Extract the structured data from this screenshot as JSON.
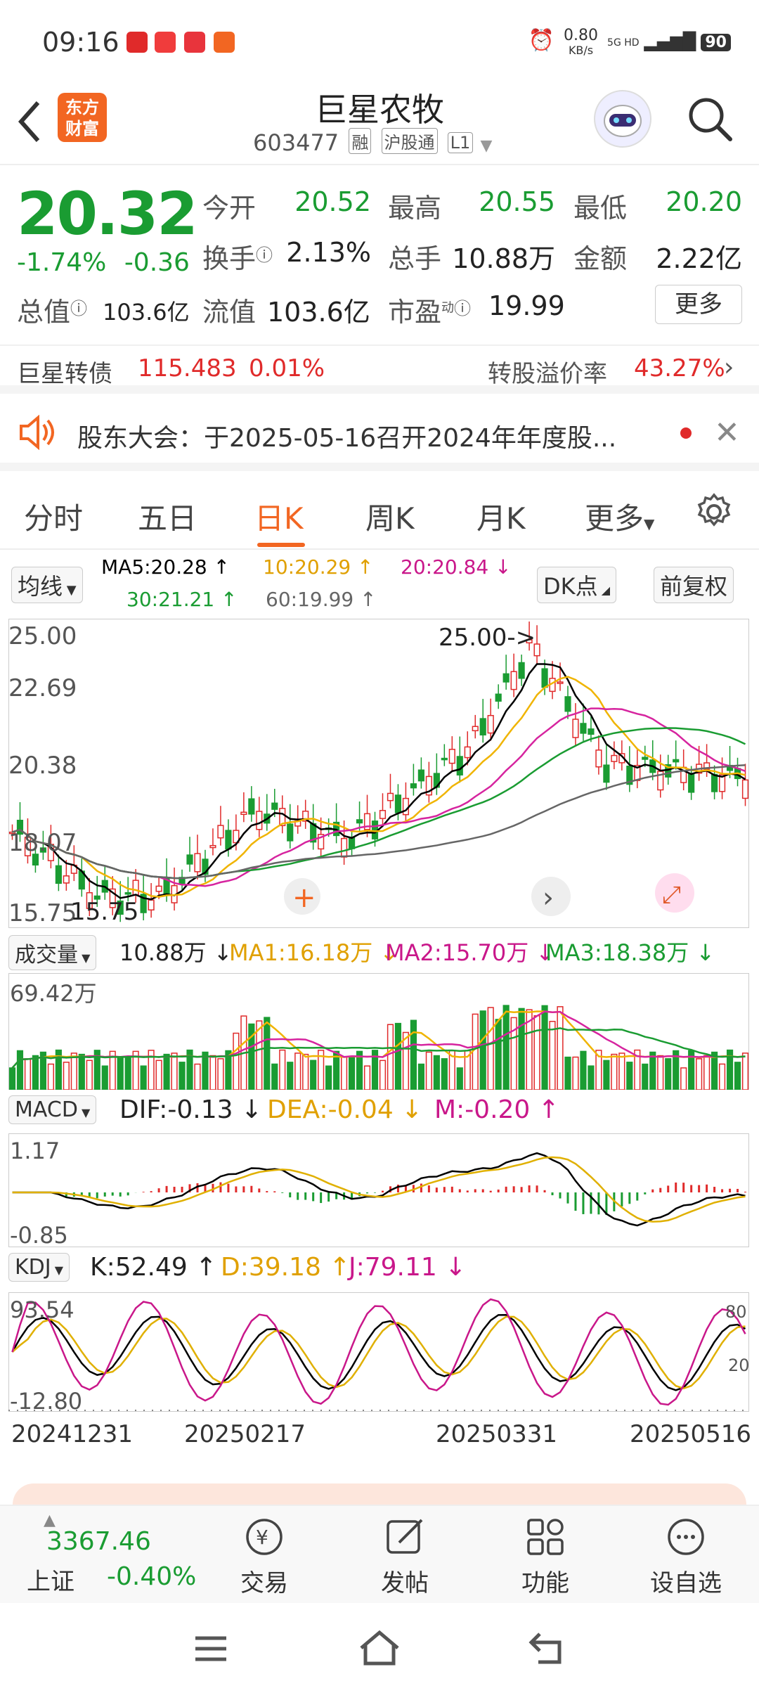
{
  "status": {
    "time": "09:16",
    "net_speed": "0.80",
    "net_unit": "KB/s",
    "net_type": "5G HD",
    "battery": "90"
  },
  "header": {
    "title": "巨星农牧",
    "code": "603477",
    "tags": [
      "融",
      "沪股通",
      "L1"
    ],
    "logo_line1": "东方",
    "logo_line2": "财富"
  },
  "quote": {
    "price": "20.32",
    "change_pct": "-1.74%",
    "change": "-0.36",
    "open_label": "今开",
    "open": "20.52",
    "high_label": "最高",
    "high": "20.55",
    "low_label": "最低",
    "low": "20.20",
    "turnover_label": "换手",
    "turnover": "2.13%",
    "volume_label": "总手",
    "volume": "10.88万",
    "amount_label": "金额",
    "amount": "2.22亿",
    "mcap_label": "总值",
    "mcap": "103.6亿",
    "float_label": "流值",
    "float": "103.6亿",
    "pe_label": "市盈",
    "pe_sup": "动",
    "pe": "19.99",
    "more_label": "更多"
  },
  "bond": {
    "name": "巨星转债",
    "price": "115.483",
    "pct": "0.01%",
    "premium_label": "转股溢价率",
    "premium": "43.27%"
  },
  "notice": {
    "text": "股东大会：于2025-05-16召开2024年年度股..."
  },
  "tabs": [
    "分时",
    "五日",
    "日K",
    "周K",
    "月K",
    "更多"
  ],
  "ma": {
    "selector": "均线",
    "ma5": "MA5:20.28 ↑",
    "ma10": "10:20.29 ↑",
    "ma20": "20:20.84 ↓",
    "ma30": "30:21.21 ↑",
    "ma60": "60:19.99 ↑",
    "dk_label": "DK点",
    "fq_label": "前复权"
  },
  "kline": {
    "ymax": "25.00",
    "y2": "22.69",
    "y3": "20.38",
    "y4": "18.07",
    "ymin": "15.75",
    "high_marker": "25.00->",
    "low_marker": "15.75"
  },
  "volume": {
    "selector": "成交量",
    "value": "10.88万 ↓",
    "ma1": "MA1:16.18万 ↓",
    "ma2": "MA2:15.70万 ↓",
    "ma3": "MA3:18.38万 ↓",
    "ymax": "69.42万"
  },
  "macd": {
    "selector": "MACD",
    "dif": "DIF:-0.13 ↓",
    "dea": "DEA:-0.04 ↓",
    "m": "M:-0.20 ↑",
    "ymax": "1.17",
    "ymin": "-0.85"
  },
  "kdj": {
    "selector": "KDJ",
    "k": "K:52.49 ↑",
    "d": "D:39.18 ↑",
    "j": "J:79.11 ↓",
    "ymax": "93.54",
    "ymin": "-12.80",
    "r80": "80",
    "r20": "20"
  },
  "xaxis": [
    "20241231",
    "20250217",
    "20250331",
    "20250516"
  ],
  "bottom": {
    "index_value": "3367.46",
    "index_name": "上证",
    "index_pct": "-0.40%",
    "trade": "交易",
    "post": "发帖",
    "func": "功能",
    "watch": "设自选"
  },
  "colors": {
    "up": "#e02a2a",
    "down": "#1a9c32",
    "accent": "#f26622",
    "ma5": "#000000",
    "ma10": "#f0b400",
    "ma20": "#d6249f",
    "ma30": "#1a9c32",
    "ma60": "#666666"
  }
}
